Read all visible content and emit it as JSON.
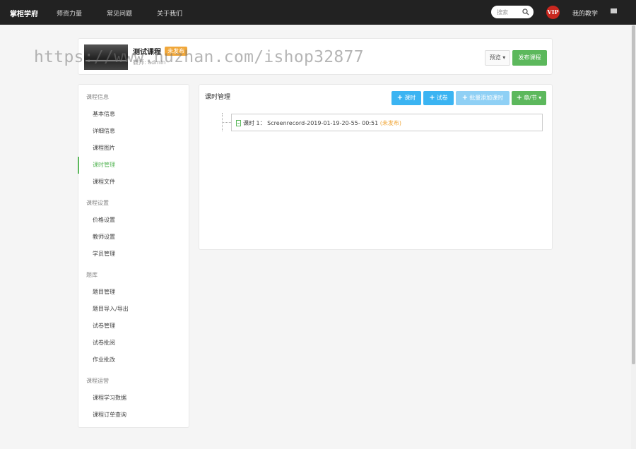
{
  "nav": {
    "brand": "掌柜学府",
    "links": [
      "师资力量",
      "常见问题",
      "关于我们"
    ],
    "search_placeholder": "搜索",
    "vip": "VIP",
    "my_teaching": "我的教学"
  },
  "course": {
    "title": "测试课程",
    "status": "未发布",
    "subtitle": "教师: admin",
    "preview_label": "预览 ▾",
    "publish_label": "发布课程"
  },
  "watermark": "https://www.huzhan.com/ishop32877",
  "sidebar": {
    "sections": [
      {
        "title": "课程信息",
        "items": [
          "基本信息",
          "详细信息",
          "课程图片",
          "课时管理",
          "课程文件"
        ]
      },
      {
        "title": "课程设置",
        "items": [
          "价格设置",
          "教师设置",
          "学员管理"
        ]
      },
      {
        "title": "题库",
        "items": [
          "题目管理",
          "题目导入/导出",
          "试卷管理",
          "试卷批阅",
          "作业批改"
        ]
      },
      {
        "title": "课程运营",
        "items": [
          "课程学习数据",
          "课程订单查询"
        ]
      }
    ],
    "active_item": "课时管理"
  },
  "main": {
    "title": "课时管理",
    "buttons": {
      "lesson": "课时",
      "exam": "试卷",
      "batch": "批量添加课时",
      "chapter": "章/节 ▾"
    },
    "colors": {
      "blue": "#3bb4f2",
      "light_blue": "#8fd0f5",
      "green": "#5cb85c",
      "orange": "#f0a73a"
    },
    "lessons": [
      {
        "text": "课时 1： Screenrecord-2019-01-19-20-55- 00:51",
        "status": "(未发布)"
      }
    ]
  }
}
